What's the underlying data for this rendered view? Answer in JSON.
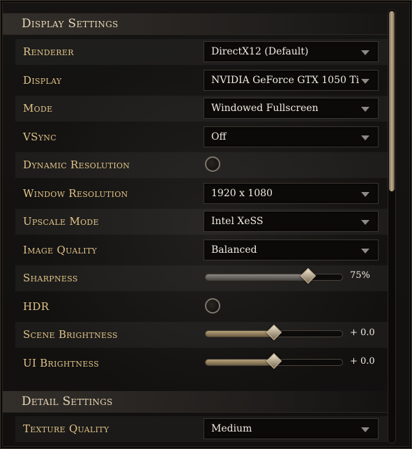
{
  "display_settings": {
    "title": "Display Settings",
    "rows": [
      {
        "label": "Renderer",
        "type": "select",
        "value": "DirectX12 (Default)"
      },
      {
        "label": "Display",
        "type": "select",
        "value": "NVIDIA GeForce GTX 1050 Ti"
      },
      {
        "label": "Mode",
        "type": "select",
        "value": "Windowed Fullscreen"
      },
      {
        "label": "VSync",
        "type": "select",
        "value": "Off"
      },
      {
        "label": "Dynamic Resolution",
        "type": "toggle",
        "checked": false
      },
      {
        "label": "Window Resolution",
        "type": "select",
        "value": "1920 x 1080"
      },
      {
        "label": "Upscale Mode",
        "type": "select",
        "value": "Intel XeSS"
      },
      {
        "label": "Image Quality",
        "type": "select",
        "value": "Balanced"
      },
      {
        "label": "Sharpness",
        "type": "slider",
        "value_text": "75%",
        "level": 0.75
      },
      {
        "label": "HDR",
        "type": "toggle",
        "checked": false
      },
      {
        "label": "Scene Brightness",
        "type": "slider",
        "value_text": "+ 0.0",
        "level": 0.5
      },
      {
        "label": "UI Brightness",
        "type": "slider",
        "value_text": "+ 0.0",
        "level": 0.5
      }
    ]
  },
  "detail_settings": {
    "title": "Detail Settings",
    "rows": [
      {
        "label": "Texture Quality",
        "type": "select",
        "value": "Medium"
      }
    ]
  },
  "scrollbar": {
    "position": 0.0
  },
  "icons": {
    "dropdown": "chevron-down-icon"
  },
  "colors": {
    "label": "#e2c488",
    "header": "#e9d9b8",
    "value": "#f1ece2",
    "slider_gold": "#b8a27a"
  }
}
